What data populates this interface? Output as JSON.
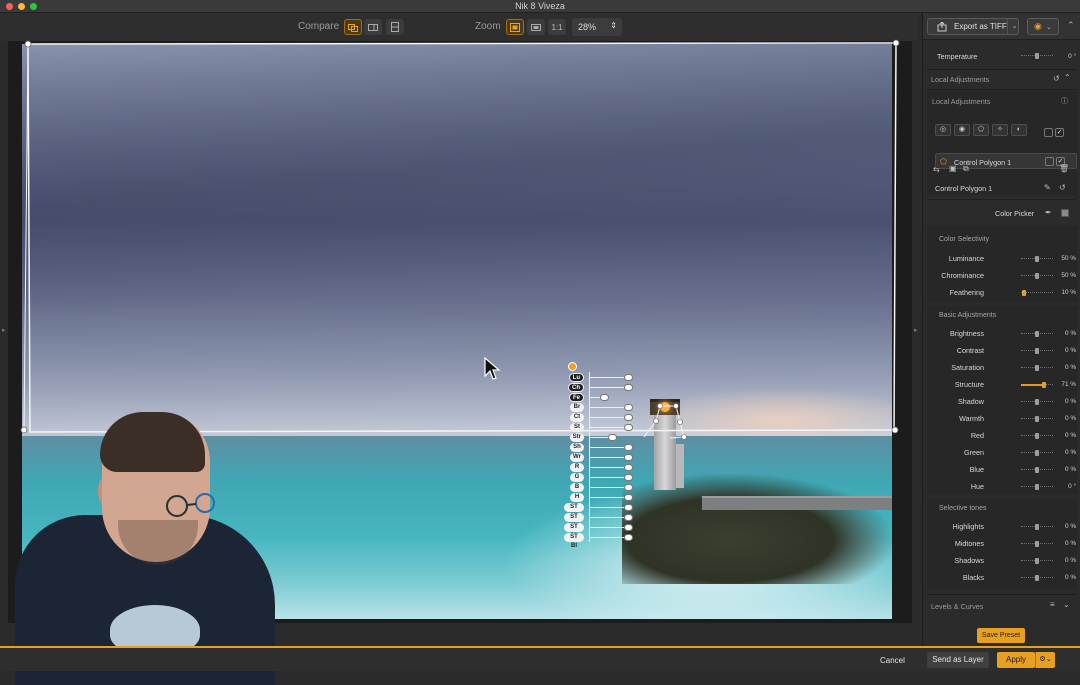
{
  "window": {
    "title": "Nik 8 Viveza"
  },
  "toolbar": {
    "compare_label": "Compare",
    "zoom_label": "Zoom",
    "zoom_1to1": "1:1",
    "zoom_value": "28%"
  },
  "control_point": {
    "labels": [
      "Lu",
      "Ch",
      "Fe",
      "Br",
      "Ct",
      "St",
      "Str",
      "Sh",
      "Wr",
      "R",
      "G",
      "B",
      "H",
      "ST Hi",
      "ST Mid",
      "ST Sh",
      "ST Bl"
    ]
  },
  "panel": {
    "export_label": "Export as TIFF",
    "temperature": {
      "label": "Temperature",
      "value": "0 °"
    },
    "local_adjustments_section": "Local Adjustments",
    "local_adjustments_title": "Local Adjustments",
    "control_polygon_item": "Control Polygon 1",
    "selected_name": "Control Polygon 1",
    "color_picker_label": "Color Picker",
    "color_selectivity": {
      "heading": "Color Selectivity",
      "items": [
        {
          "label": "Luminance",
          "value": "50 %",
          "level": 0.5
        },
        {
          "label": "Chrominance",
          "value": "50 %",
          "level": 0.5
        },
        {
          "label": "Feathering",
          "value": "10 %",
          "level": 0.1
        }
      ]
    },
    "basic_adjustments": {
      "heading": "Basic Adjustments",
      "items": [
        {
          "label": "Brightness",
          "value": "0 %",
          "level": 0.5
        },
        {
          "label": "Contrast",
          "value": "0 %",
          "level": 0.5
        },
        {
          "label": "Saturation",
          "value": "0 %",
          "level": 0.5
        },
        {
          "label": "Structure",
          "value": "71 %",
          "level": 0.71,
          "highlight": true
        },
        {
          "label": "Shadow",
          "value": "0 %",
          "level": 0.5
        },
        {
          "label": "Warmth",
          "value": "0 %",
          "level": 0.5
        },
        {
          "label": "Red",
          "value": "0 %",
          "level": 0.5
        },
        {
          "label": "Green",
          "value": "0 %",
          "level": 0.5
        },
        {
          "label": "Blue",
          "value": "0 %",
          "level": 0.5
        },
        {
          "label": "Hue",
          "value": "0 °",
          "level": 0.5
        }
      ]
    },
    "selective_tones": {
      "heading": "Selective tones",
      "items": [
        {
          "label": "Highlights",
          "value": "0 %",
          "level": 0.5
        },
        {
          "label": "Midtones",
          "value": "0 %",
          "level": 0.5
        },
        {
          "label": "Shadows",
          "value": "0 %",
          "level": 0.5
        },
        {
          "label": "Blacks",
          "value": "0 %",
          "level": 0.5
        }
      ]
    },
    "levels_curves": "Levels & Curves",
    "save_preset": "Save Preset"
  },
  "bottombar": {
    "cancel": "Cancel",
    "send_as_layer": "Send as Layer",
    "apply": "Apply"
  },
  "colors": {
    "accent": "#e8a020"
  }
}
